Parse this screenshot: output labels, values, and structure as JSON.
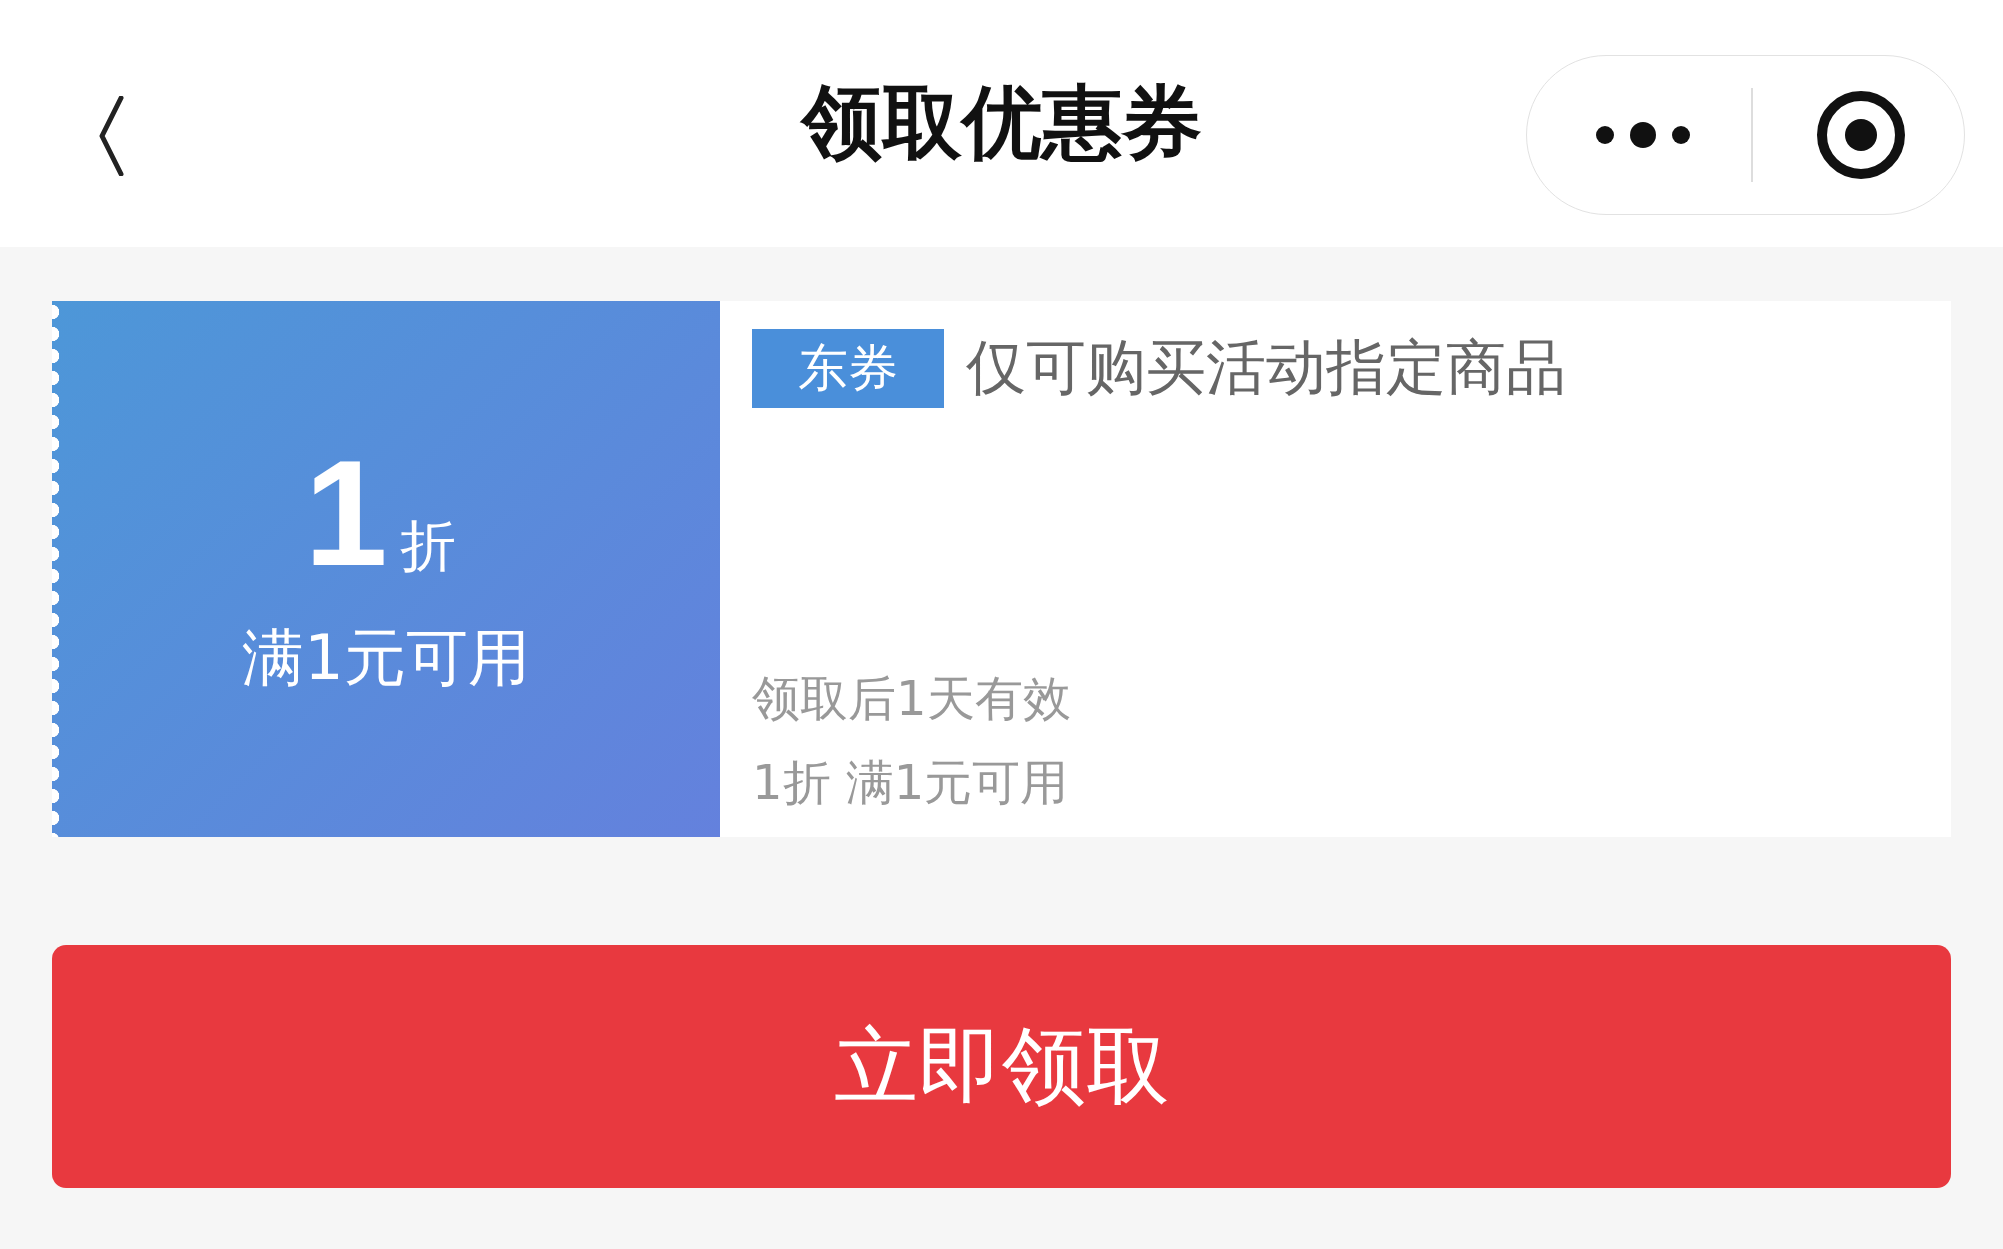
{
  "header": {
    "title": "领取优惠券"
  },
  "coupon": {
    "value": "1",
    "unit": "折",
    "condition": "满1元可用",
    "tag": "东券",
    "description": "仅可购买活动指定商品",
    "validity": "领取后1天有效",
    "detail": "1折 满1元可用"
  },
  "claim_button": {
    "label": "立即领取"
  }
}
